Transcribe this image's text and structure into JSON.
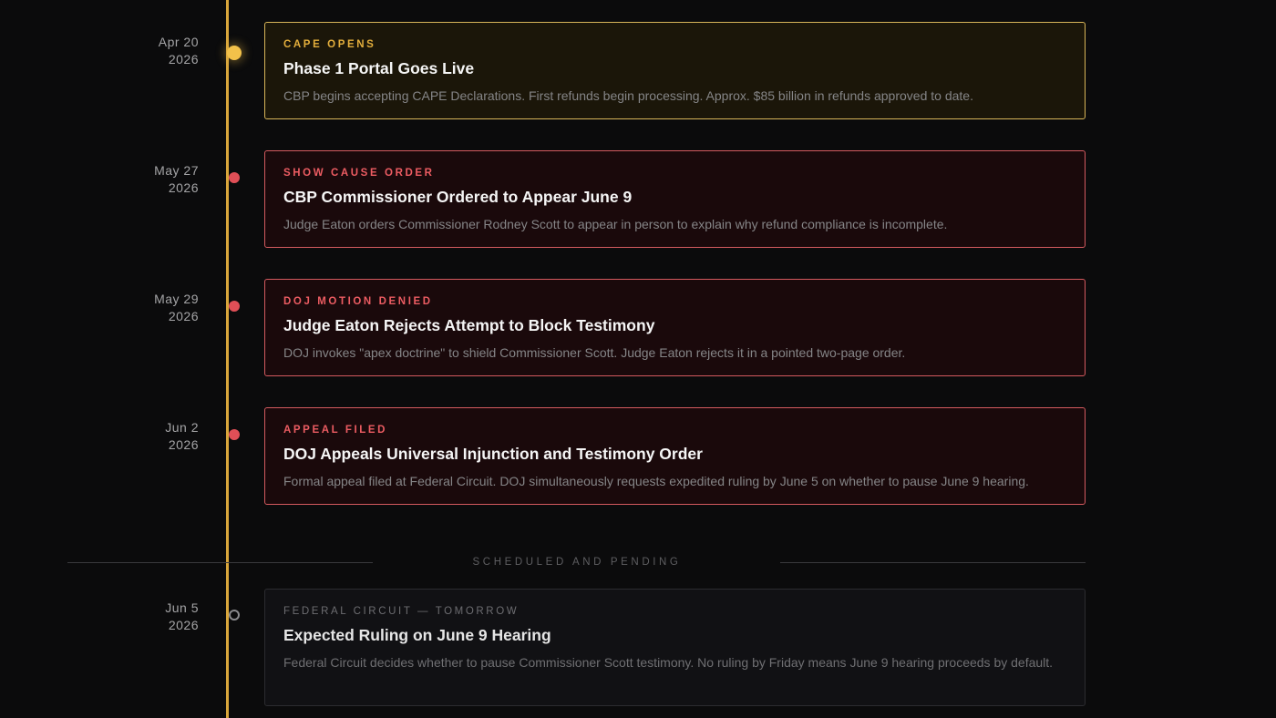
{
  "timeline": {
    "events": [
      {
        "date_line1": "Apr 20",
        "date_line2": "2026",
        "tag": "CAPE OPENS",
        "title": "Phase 1 Portal Goes Live",
        "description": "CBP begins accepting CAPE Declarations. First refunds begin processing. Approx. $85 billion in refunds approved to date."
      },
      {
        "date_line1": "May 27",
        "date_line2": "2026",
        "tag": "SHOW CAUSE ORDER",
        "title": "CBP Commissioner Ordered to Appear June 9",
        "description": "Judge Eaton orders Commissioner Rodney Scott to appear in person to explain why refund compliance is incomplete."
      },
      {
        "date_line1": "May 29",
        "date_line2": "2026",
        "tag": "DOJ MOTION DENIED",
        "title": "Judge Eaton Rejects Attempt to Block Testimony",
        "description": "DOJ invokes \"apex doctrine\" to shield Commissioner Scott. Judge Eaton rejects it in a pointed two-page order."
      },
      {
        "date_line1": "Jun 2",
        "date_line2": "2026",
        "tag": "APPEAL FILED",
        "title": "DOJ Appeals Universal Injunction and Testimony Order",
        "description": "Formal appeal filed at Federal Circuit. DOJ simultaneously requests expedited ruling by June 5 on whether to pause June 9 hearing."
      }
    ],
    "divider_label": "SCHEDULED AND PENDING",
    "pending": [
      {
        "date_line1": "Jun 5",
        "date_line2": "2026",
        "tag": "FEDERAL CIRCUIT — TOMORROW",
        "title": "Expected Ruling on June 9 Hearing",
        "description": "Federal Circuit decides whether to pause Commissioner Scott testimony. No ruling by Friday means June 9 hearing proceeds by default."
      }
    ]
  },
  "colors": {
    "spine": "#d9a63b",
    "gold_accent": "#f2c14a",
    "red_accent": "#e04f57",
    "pending_grey": "#8a8a8d",
    "background": "#0b0b0c"
  }
}
